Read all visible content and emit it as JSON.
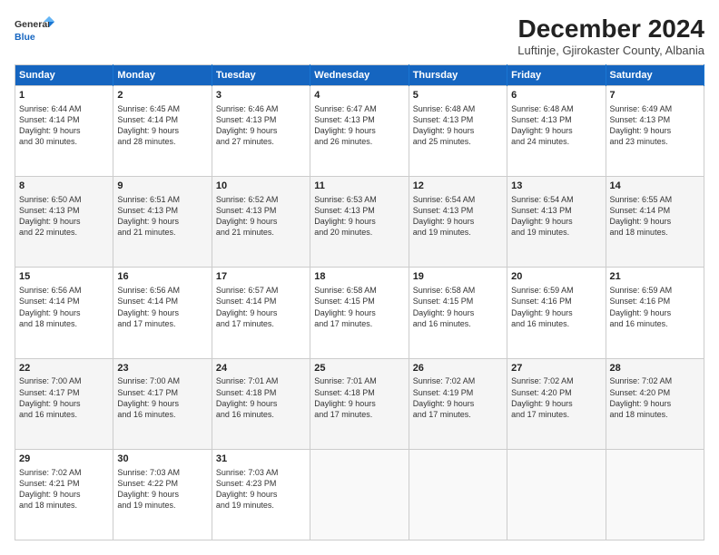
{
  "logo": {
    "line1": "General",
    "line2": "Blue"
  },
  "title": "December 2024",
  "subtitle": "Luftinje, Gjirokaster County, Albania",
  "weekdays": [
    "Sunday",
    "Monday",
    "Tuesday",
    "Wednesday",
    "Thursday",
    "Friday",
    "Saturday"
  ],
  "weeks": [
    [
      {
        "day": "1",
        "info": "Sunrise: 6:44 AM\nSunset: 4:14 PM\nDaylight: 9 hours\nand 30 minutes."
      },
      {
        "day": "2",
        "info": "Sunrise: 6:45 AM\nSunset: 4:14 PM\nDaylight: 9 hours\nand 28 minutes."
      },
      {
        "day": "3",
        "info": "Sunrise: 6:46 AM\nSunset: 4:13 PM\nDaylight: 9 hours\nand 27 minutes."
      },
      {
        "day": "4",
        "info": "Sunrise: 6:47 AM\nSunset: 4:13 PM\nDaylight: 9 hours\nand 26 minutes."
      },
      {
        "day": "5",
        "info": "Sunrise: 6:48 AM\nSunset: 4:13 PM\nDaylight: 9 hours\nand 25 minutes."
      },
      {
        "day": "6",
        "info": "Sunrise: 6:48 AM\nSunset: 4:13 PM\nDaylight: 9 hours\nand 24 minutes."
      },
      {
        "day": "7",
        "info": "Sunrise: 6:49 AM\nSunset: 4:13 PM\nDaylight: 9 hours\nand 23 minutes."
      }
    ],
    [
      {
        "day": "8",
        "info": "Sunrise: 6:50 AM\nSunset: 4:13 PM\nDaylight: 9 hours\nand 22 minutes."
      },
      {
        "day": "9",
        "info": "Sunrise: 6:51 AM\nSunset: 4:13 PM\nDaylight: 9 hours\nand 21 minutes."
      },
      {
        "day": "10",
        "info": "Sunrise: 6:52 AM\nSunset: 4:13 PM\nDaylight: 9 hours\nand 21 minutes."
      },
      {
        "day": "11",
        "info": "Sunrise: 6:53 AM\nSunset: 4:13 PM\nDaylight: 9 hours\nand 20 minutes."
      },
      {
        "day": "12",
        "info": "Sunrise: 6:54 AM\nSunset: 4:13 PM\nDaylight: 9 hours\nand 19 minutes."
      },
      {
        "day": "13",
        "info": "Sunrise: 6:54 AM\nSunset: 4:13 PM\nDaylight: 9 hours\nand 19 minutes."
      },
      {
        "day": "14",
        "info": "Sunrise: 6:55 AM\nSunset: 4:14 PM\nDaylight: 9 hours\nand 18 minutes."
      }
    ],
    [
      {
        "day": "15",
        "info": "Sunrise: 6:56 AM\nSunset: 4:14 PM\nDaylight: 9 hours\nand 18 minutes."
      },
      {
        "day": "16",
        "info": "Sunrise: 6:56 AM\nSunset: 4:14 PM\nDaylight: 9 hours\nand 17 minutes."
      },
      {
        "day": "17",
        "info": "Sunrise: 6:57 AM\nSunset: 4:14 PM\nDaylight: 9 hours\nand 17 minutes."
      },
      {
        "day": "18",
        "info": "Sunrise: 6:58 AM\nSunset: 4:15 PM\nDaylight: 9 hours\nand 17 minutes."
      },
      {
        "day": "19",
        "info": "Sunrise: 6:58 AM\nSunset: 4:15 PM\nDaylight: 9 hours\nand 16 minutes."
      },
      {
        "day": "20",
        "info": "Sunrise: 6:59 AM\nSunset: 4:16 PM\nDaylight: 9 hours\nand 16 minutes."
      },
      {
        "day": "21",
        "info": "Sunrise: 6:59 AM\nSunset: 4:16 PM\nDaylight: 9 hours\nand 16 minutes."
      }
    ],
    [
      {
        "day": "22",
        "info": "Sunrise: 7:00 AM\nSunset: 4:17 PM\nDaylight: 9 hours\nand 16 minutes."
      },
      {
        "day": "23",
        "info": "Sunrise: 7:00 AM\nSunset: 4:17 PM\nDaylight: 9 hours\nand 16 minutes."
      },
      {
        "day": "24",
        "info": "Sunrise: 7:01 AM\nSunset: 4:18 PM\nDaylight: 9 hours\nand 16 minutes."
      },
      {
        "day": "25",
        "info": "Sunrise: 7:01 AM\nSunset: 4:18 PM\nDaylight: 9 hours\nand 17 minutes."
      },
      {
        "day": "26",
        "info": "Sunrise: 7:02 AM\nSunset: 4:19 PM\nDaylight: 9 hours\nand 17 minutes."
      },
      {
        "day": "27",
        "info": "Sunrise: 7:02 AM\nSunset: 4:20 PM\nDaylight: 9 hours\nand 17 minutes."
      },
      {
        "day": "28",
        "info": "Sunrise: 7:02 AM\nSunset: 4:20 PM\nDaylight: 9 hours\nand 18 minutes."
      }
    ],
    [
      {
        "day": "29",
        "info": "Sunrise: 7:02 AM\nSunset: 4:21 PM\nDaylight: 9 hours\nand 18 minutes."
      },
      {
        "day": "30",
        "info": "Sunrise: 7:03 AM\nSunset: 4:22 PM\nDaylight: 9 hours\nand 19 minutes."
      },
      {
        "day": "31",
        "info": "Sunrise: 7:03 AM\nSunset: 4:23 PM\nDaylight: 9 hours\nand 19 minutes."
      },
      {
        "day": "",
        "info": ""
      },
      {
        "day": "",
        "info": ""
      },
      {
        "day": "",
        "info": ""
      },
      {
        "day": "",
        "info": ""
      }
    ]
  ]
}
